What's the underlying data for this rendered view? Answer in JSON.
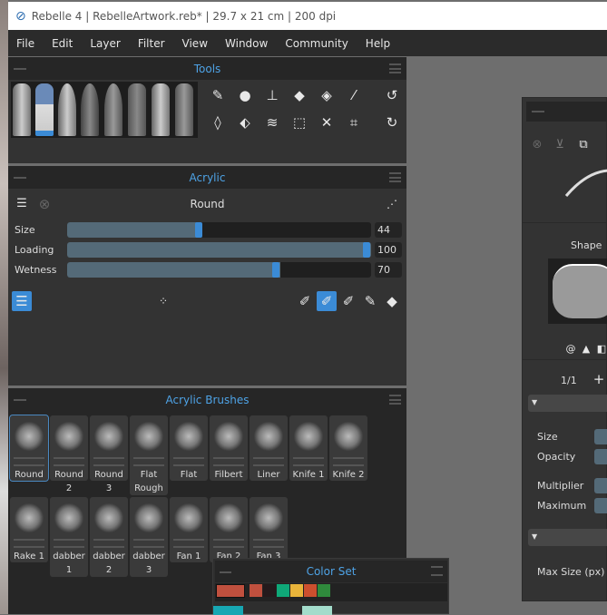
{
  "window": {
    "title": "Rebelle 4 | RebelleArtwork.reb* | 29.7 x 21 cm | 200 dpi"
  },
  "menu": [
    "File",
    "Edit",
    "Layer",
    "Filter",
    "View",
    "Window",
    "Community",
    "Help"
  ],
  "tools_panel": {
    "title": "Tools",
    "brush_tools": [
      "brush-wide",
      "brush-blue",
      "brush-round",
      "ink-pen",
      "pencil",
      "marker",
      "felt-pen",
      "airbrush"
    ],
    "icons_row1": [
      "pencil-icon",
      "blend-icon",
      "stamp-icon",
      "eraser-icon",
      "fill-bucket-icon",
      "eyedropper-icon",
      "undo-icon"
    ],
    "icons_row2": [
      "water-drop-icon",
      "blot-icon",
      "blow-icon",
      "selection-icon",
      "transform-icon",
      "crop-icon",
      "redo-icon"
    ]
  },
  "acrylic_panel": {
    "title": "Acrylic",
    "preset": "Round",
    "sliders": [
      {
        "label": "Size",
        "value": 44,
        "fill": 0.44
      },
      {
        "label": "Loading",
        "value": 100,
        "fill": 1.0
      },
      {
        "label": "Wetness",
        "value": 70,
        "fill": 0.7
      }
    ]
  },
  "brushes_panel": {
    "title": "Acrylic Brushes",
    "row1": [
      "Round",
      "Round 2",
      "Round 3",
      "Flat Rough",
      "Flat",
      "Filbert",
      "Liner",
      "Knife 1",
      "Knife 2"
    ],
    "row2": [
      "Rake 1",
      "dabber 1",
      "dabber 2",
      "dabber 3",
      "Fan 1",
      "Fan 2",
      "Fan 3"
    ],
    "selected": "Round"
  },
  "color_set": {
    "title": "Color Set",
    "current": "#c0503e",
    "swatches": [
      "#c0503e",
      "#241a1c",
      "#0fa878",
      "#e8b43a",
      "#cc4f2e",
      "#2f8a3c"
    ]
  },
  "brush_creator": {
    "shape_label": "Shape",
    "page": "1/1",
    "rows1": [
      "Size",
      "Opacity"
    ],
    "rows2": [
      "Multiplier",
      "Maximum"
    ],
    "max_size_label": "Max Size (px)"
  },
  "colors": {
    "accent": "#4ea3e6",
    "slider": "#546a78",
    "knob": "#3b8bd6"
  }
}
